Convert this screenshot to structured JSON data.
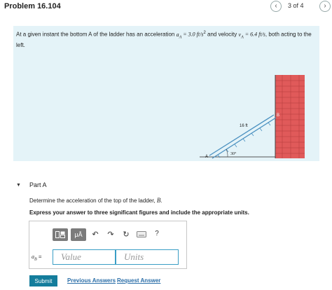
{
  "header": {
    "title": "Problem 16.104",
    "page_indicator": "3 of 4",
    "prev_icon": "chevron-left-icon",
    "next_icon": "chevron-right-icon"
  },
  "problem": {
    "text_part1": "At a given instant the bottom A of the ladder has an acceleration ",
    "accel_expr": "a",
    "accel_sub": "A",
    "accel_value": " = 3.0 ft/s",
    "accel_sup": "2",
    "text_part2": " and velocity ",
    "vel_expr": "v",
    "vel_sub": "A",
    "vel_value": " = 6.4 ft/s",
    "text_part3": ", both acting to the left.",
    "figure": {
      "length_label": "16 ft",
      "angle_label": "30°",
      "point_a": "A",
      "point_b": "B",
      "wall_color": "#e05a5a"
    }
  },
  "part": {
    "title": "Part A",
    "question_prefix": "Determine the acceleration of the top of the ladder, ",
    "question_var": "B",
    "question_suffix": ".",
    "instruction": "Express your answer to three significant figures and include the appropriate units."
  },
  "answer": {
    "label_var": "a",
    "label_sub": "B",
    "label_eq": " =",
    "value_placeholder": "Value",
    "units_placeholder": "Units",
    "toolbar": {
      "templates_icon": "templates-icon",
      "units_button_label": "μÅ",
      "undo_icon": "undo-icon",
      "redo_icon": "redo-icon",
      "reset_icon": "reset-icon",
      "keyboard_icon": "keyboard-icon",
      "help_label": "?"
    }
  },
  "actions": {
    "submit_label": "Submit",
    "previous_answers_label": "Previous Answers",
    "request_answer_label": "Request Answer"
  },
  "colors": {
    "accent": "#147d9c",
    "link": "#2a6ea8",
    "problem_bg": "#e4f3f8",
    "input_border": "#3a9ec5"
  }
}
